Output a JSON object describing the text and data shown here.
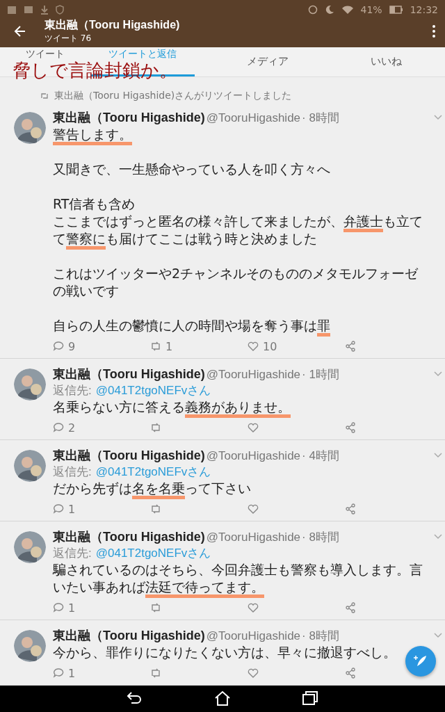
{
  "status_bar": {
    "battery": "41%",
    "time": "12:32"
  },
  "header": {
    "title": "東出融（Tooru Higashide)",
    "subtitle": "ツイート 76"
  },
  "tabs": [
    {
      "label": "ツイート",
      "selected": false
    },
    {
      "label": "ツイートと返信",
      "selected": true
    },
    {
      "label": "メディア",
      "selected": false
    },
    {
      "label": "いいね",
      "selected": false
    }
  ],
  "annotation": "脅しで言論封鎖か。",
  "retweet_notice": "東出融（Tooru Higashide)さんがリツイートしました",
  "tweets": [
    {
      "name": "東出融（Tooru Higashide)",
      "handle": "@TooruHigashide",
      "time": "· 8時間",
      "paragraphs": [
        [
          [
            {
              "text": "警告します。",
              "underlined": true
            }
          ]
        ],
        [
          [
            {
              "text": "又聞きで、一生懸命やっている人を叩く方々へ",
              "underlined": false
            }
          ]
        ],
        [
          [
            {
              "text": "RT信者も含め",
              "underlined": false
            }
          ],
          [
            {
              "text": "ここまではずっと匿名の様々許して来ましたが、",
              "underlined": false
            },
            {
              "text": "弁護士",
              "underlined": true
            },
            {
              "text": "も立てて",
              "underlined": false
            },
            {
              "text": "警察に",
              "underlined": true
            },
            {
              "text": "も届けてここは戦う時と決めました",
              "underlined": false
            }
          ]
        ],
        [
          [
            {
              "text": "これはツイッターや2チャンネルそのもののメタモルフォーゼの戦いです",
              "underlined": false
            }
          ]
        ],
        [
          [
            {
              "text": "自らの人生の鬱憤に人の時間や場を奪う事は",
              "underlined": false
            },
            {
              "text": "罪",
              "underlined": true
            }
          ]
        ]
      ],
      "replies": "9",
      "retweets": "1",
      "likes": "10"
    },
    {
      "name": "東出融（Tooru Higashide)",
      "handle": "@TooruHigashide",
      "time": "· 1時間",
      "reply_label": "返信先:",
      "reply_to": "@041T2tgoNEFvさん",
      "paragraphs": [
        [
          [
            {
              "text": "名乗らない方に答える",
              "underlined": false
            },
            {
              "text": "義務がありませ。",
              "underlined": true
            }
          ]
        ]
      ],
      "replies": "2"
    },
    {
      "name": "東出融（Tooru Higashide)",
      "handle": "@TooruHigashide",
      "time": "· 4時間",
      "reply_label": "返信先:",
      "reply_to": "@041T2tgoNEFvさん",
      "paragraphs": [
        [
          [
            {
              "text": "だから先ずは",
              "underlined": false
            },
            {
              "text": "名を名乗",
              "underlined": true
            },
            {
              "text": "って下さい",
              "underlined": false
            }
          ]
        ]
      ],
      "replies": "1"
    },
    {
      "name": "東出融（Tooru Higashide)",
      "handle": "@TooruHigashide",
      "time": "· 8時間",
      "reply_label": "返信先:",
      "reply_to": "@041T2tgoNEFvさん",
      "paragraphs": [
        [
          [
            {
              "text": "騙されているのはそちら、今回弁護士も警察も導入します。言いたい事あれば",
              "underlined": false
            },
            {
              "text": "法廷で待ってます。",
              "underlined": true
            }
          ]
        ]
      ],
      "replies": "1"
    },
    {
      "name": "東出融（Tooru Higashide)",
      "handle": "@TooruHigashide",
      "time": "· 8時間",
      "paragraphs": [
        [
          [
            {
              "text": "今から、罪作りになりたくない方は、早々に撤退すべし。",
              "underlined": false
            }
          ]
        ]
      ],
      "replies": "1"
    }
  ]
}
